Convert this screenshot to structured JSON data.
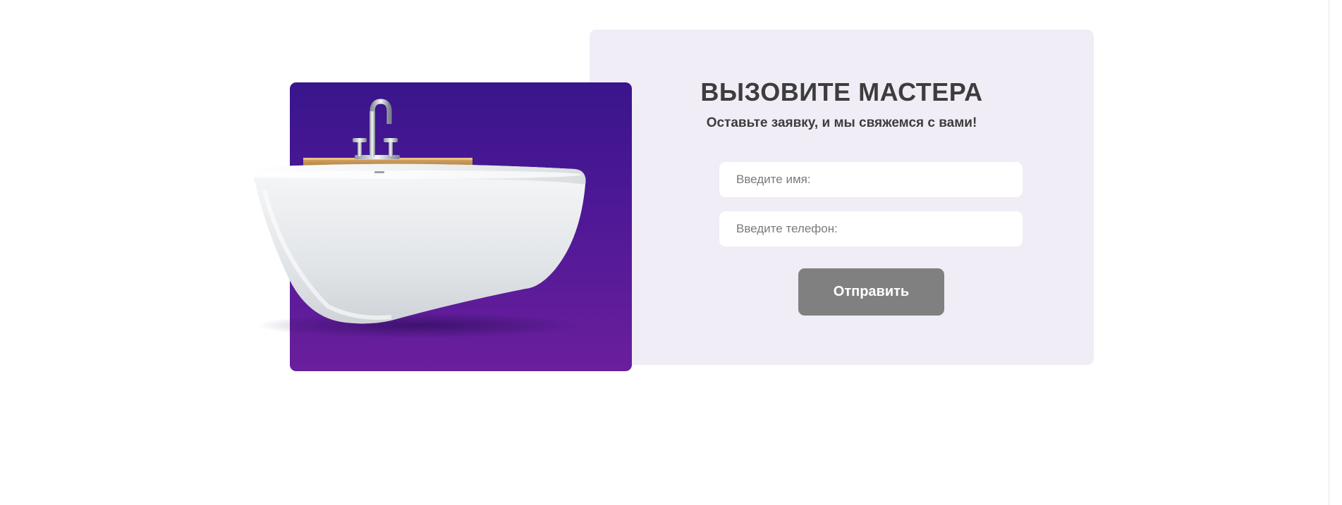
{
  "form": {
    "title": "ВЫЗОВИТЕ МАСТЕРА",
    "subtitle": "Оставьте заявку, и мы свяжемся с вами!",
    "name_input": {
      "placeholder": "Введите имя:",
      "value": ""
    },
    "phone_input": {
      "placeholder": "Введите телефон:",
      "value": ""
    },
    "submit_label": "Отправить"
  },
  "image": {
    "icon": "bathtub-image"
  },
  "colors": {
    "card_background": "#f0edf6",
    "image_gradient_top": "#39158c",
    "image_gradient_bottom": "#6a1f9c",
    "button_background": "#808080",
    "heading_text": "#3d3d3d"
  }
}
